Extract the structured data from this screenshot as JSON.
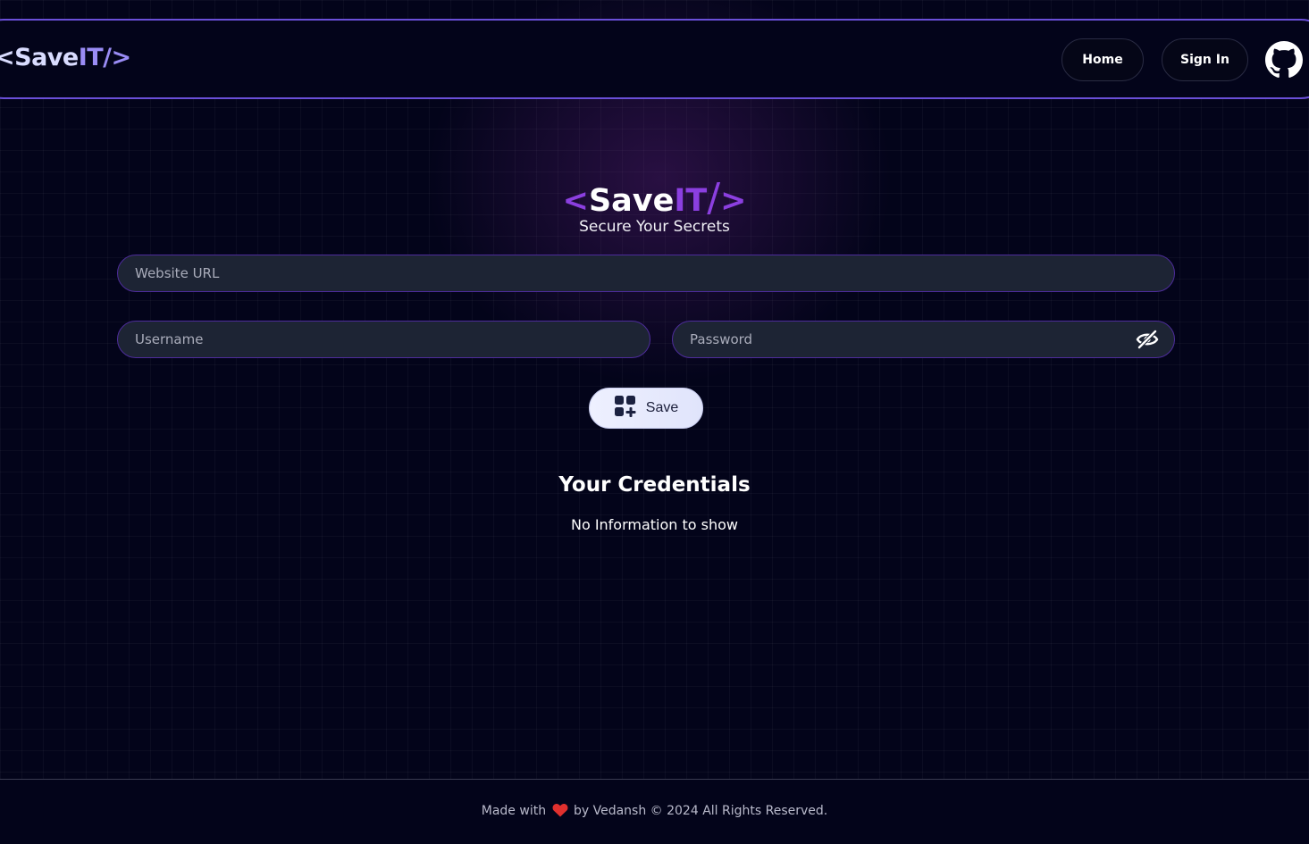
{
  "navbar": {
    "logo_open": "<",
    "logo_text": "Save",
    "logo_accent": "IT/>",
    "home_label": "Home",
    "signin_label": "Sign In",
    "github_icon": "github-icon"
  },
  "hero": {
    "bracket_open": "<",
    "title_save": "Save",
    "title_it": "IT",
    "title_slash": "/",
    "bracket_close": ">",
    "tagline": "Secure Your Secrets"
  },
  "form": {
    "website_placeholder": "Website URL",
    "username_placeholder": "Username",
    "password_placeholder": "Password",
    "eye_icon": "eye-slash-icon",
    "save_label": "Save",
    "save_icon": "add-grid-icon"
  },
  "credentials": {
    "title": "Your Credentials",
    "empty_message": "No Information to show"
  },
  "footer": {
    "prefix": "Made with",
    "suffix": "by Vedansh © 2024 All Rights Reserved.",
    "heart_icon": "heart-icon"
  },
  "colors": {
    "background": "#03041a",
    "accent_purple": "#8b3fe0",
    "nav_border": "#6a4fd8",
    "input_bg": "#1d2434",
    "input_border": "#4d2c9b",
    "heart": "#e0302e"
  }
}
